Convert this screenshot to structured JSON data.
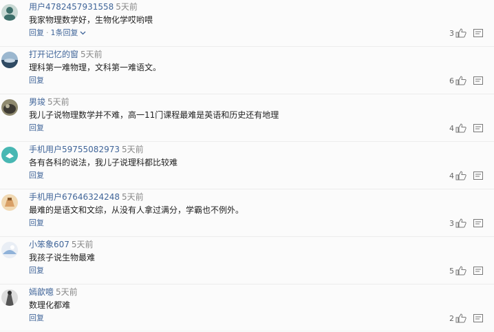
{
  "comments": [
    {
      "username": "用户4782457931558",
      "time": "5天前",
      "text": "我家物理数学好，生物化学哎哟喂",
      "reply_label": "回复",
      "reply_sep": "·",
      "replies_label": "1条回复",
      "likes": "3",
      "avatar_colors": [
        "#3d6f6a",
        "#c9d9d4"
      ]
    },
    {
      "username": "打开记忆的窗",
      "time": "5天前",
      "text": "理科第一难物理，文科第一难语文。",
      "reply_label": "回复",
      "likes": "6",
      "avatar_colors": [
        "#2f4a63",
        "#9bb7cf"
      ]
    },
    {
      "username": "男竣",
      "time": "5天前",
      "text": "我儿子说物理数学并不难，高一11门课程最难是英语和历史还有地理",
      "reply_label": "回复",
      "likes": "4",
      "avatar_colors": [
        "#3d3a33",
        "#8f8a6f"
      ]
    },
    {
      "username": "手机用户59755082973",
      "time": "5天前",
      "text": "各有各科的说法，我儿子说理科都比较难",
      "reply_label": "回复",
      "likes": "4",
      "avatar_colors": [
        "#48b7b3",
        "#ffffff"
      ]
    },
    {
      "username": "手机用户67646324248",
      "time": "5天前",
      "text": "最难的是语文和文综，从没有人拿过满分，学霸也不例外。",
      "reply_label": "回复",
      "likes": "3",
      "avatar_colors": [
        "#d9a066",
        "#f1d9b3"
      ]
    },
    {
      "username": "小笨象607",
      "time": "5天前",
      "text": "我孩子说生物最难",
      "reply_label": "回复",
      "likes": "5",
      "avatar_colors": [
        "#8fb2d9",
        "#e9eef5"
      ]
    },
    {
      "username": "嫣歆噫",
      "time": "5天前",
      "text": "数理化都难",
      "reply_label": "回复",
      "likes": "2",
      "avatar_colors": [
        "#555555",
        "#dddddd"
      ]
    }
  ],
  "icons": {
    "like": "thumbs-up-icon",
    "report": "report-icon",
    "chevron": "chevron-down-icon"
  },
  "colors": {
    "username": "#406599",
    "action": "#406599",
    "time": "#888888"
  }
}
